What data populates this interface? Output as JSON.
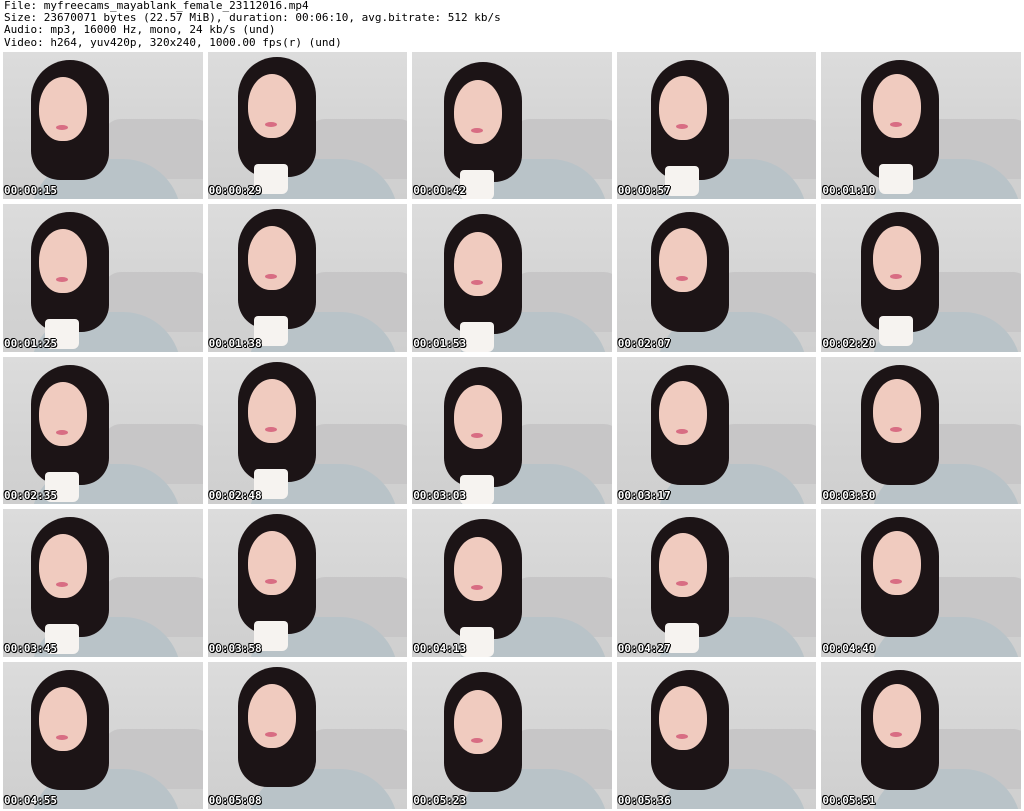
{
  "header": {
    "file_line": "File: myfreecams_mayablank_female_23112016.mp4",
    "size_line": "Size: 23670071 bytes (22.57 MiB), duration: 00:06:10, avg.bitrate: 512 kb/s",
    "audio_line": "Audio: mp3, 16000 Hz, mono, 24 kb/s (und)",
    "video_line": "Video: h264, yuv420p, 320x240, 1000.00 fps(r) (und)"
  },
  "thumbnails": [
    {
      "timestamp": "00:00:15"
    },
    {
      "timestamp": "00:00:29"
    },
    {
      "timestamp": "00:00:42"
    },
    {
      "timestamp": "00:00:57"
    },
    {
      "timestamp": "00:01:10"
    },
    {
      "timestamp": "00:01:25"
    },
    {
      "timestamp": "00:01:38"
    },
    {
      "timestamp": "00:01:53"
    },
    {
      "timestamp": "00:02:07"
    },
    {
      "timestamp": "00:02:20"
    },
    {
      "timestamp": "00:02:35"
    },
    {
      "timestamp": "00:02:48"
    },
    {
      "timestamp": "00:03:03"
    },
    {
      "timestamp": "00:03:17"
    },
    {
      "timestamp": "00:03:30"
    },
    {
      "timestamp": "00:03:45"
    },
    {
      "timestamp": "00:03:58"
    },
    {
      "timestamp": "00:04:13"
    },
    {
      "timestamp": "00:04:27"
    },
    {
      "timestamp": "00:04:40"
    },
    {
      "timestamp": "00:04:55"
    },
    {
      "timestamp": "00:05:08"
    },
    {
      "timestamp": "00:05:23"
    },
    {
      "timestamp": "00:05:36"
    },
    {
      "timestamp": "00:05:51"
    }
  ]
}
